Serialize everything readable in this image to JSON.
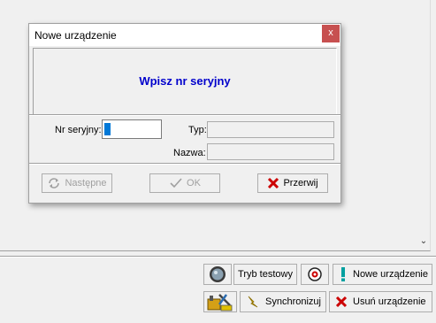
{
  "dialog": {
    "title": "Nowe urządzenie",
    "close_glyph": "x",
    "prompt": "Wpisz nr seryjny",
    "serial_label": "Nr seryjny:",
    "serial_value": "",
    "type_label": "Typ:",
    "type_value": "",
    "name_label": "Nazwa:",
    "name_value": "",
    "buttons": {
      "next": "Następne",
      "ok": "OK",
      "cancel": "Przerwij"
    }
  },
  "app": {
    "scroll_glyph": "⌄"
  },
  "toolbar": {
    "test_mode": "Tryb testowy",
    "new_device": "Nowe urządzenie",
    "sync": "Synchronizuj",
    "delete_device": "Usuń urządzenie"
  },
  "colors": {
    "accent": "#0000cc",
    "close_bg": "#c75050",
    "cancel_icon": "#cc0000",
    "new_icon": "#00a0a0"
  },
  "icons": [
    "refresh-icon",
    "check-icon",
    "x-icon",
    "test-mode-icon",
    "siren-icon",
    "exclamation-icon",
    "tools-icon",
    "lightning-icon",
    "red-x-icon"
  ]
}
